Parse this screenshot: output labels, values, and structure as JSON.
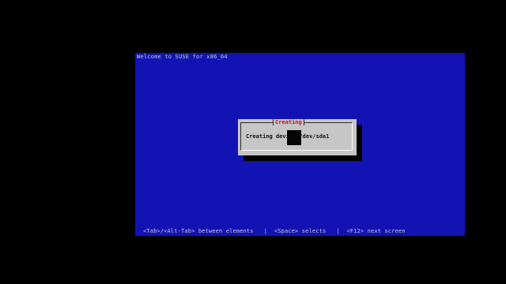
{
  "installer": {
    "welcome_text": "Welcome to SUSE for x86_64"
  },
  "dialog": {
    "title": "Creating",
    "message": "Creating device /dev/sda1"
  },
  "status_bar": {
    "text": "<Tab>/<Alt-Tab> between elements   |  <Space> selects   |  <F12> next screen"
  },
  "colors": {
    "screen_background": "#1313b4",
    "dialog_background": "#c6c6c6",
    "dialog_title": "#c81414"
  }
}
